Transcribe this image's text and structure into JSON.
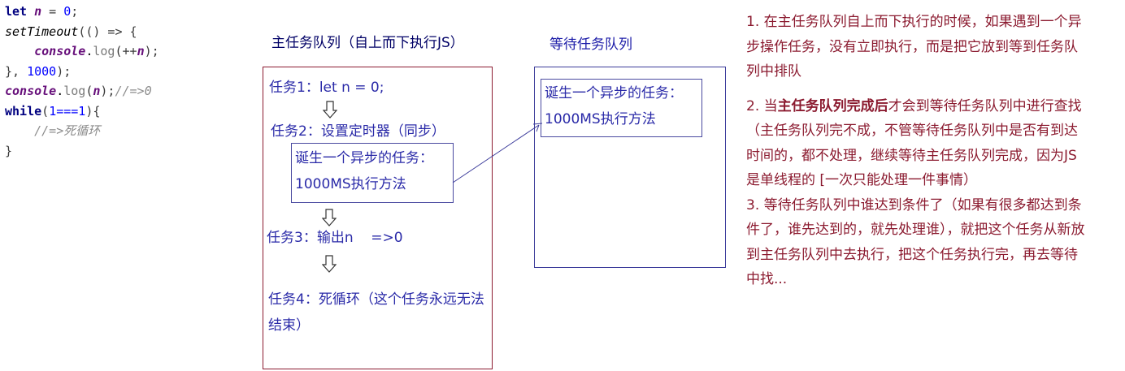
{
  "code": {
    "l1_kw": "let",
    "l1_var": "n",
    "l1_rest": " = ",
    "l1_num": "0",
    "l1_end": ";",
    "l2_fn": "setTimeout",
    "l2_rest": "(() => {",
    "l3_obj": "console",
    "l3_dot": ".",
    "l3_method": "log",
    "l3_open": "(++",
    "l3_var": "n",
    "l3_close": ");",
    "l4_start": "}, ",
    "l4_num": "1000",
    "l4_end": ");",
    "l5_obj": "console",
    "l5_dot": ".",
    "l5_method": "log",
    "l5_open": "(",
    "l5_var": "n",
    "l5_close": ");",
    "l5_comment": "//=>0",
    "l6_kw": "while",
    "l6_rest": "(",
    "l6_cond": "1===1",
    "l6_end": "){",
    "l7_comment": "//=>死循环",
    "l8": "}"
  },
  "diagram": {
    "main_title": "主任务队列（自上而下执行JS）",
    "wait_title": "等待任务队列",
    "task1": "任务1：let n = 0;",
    "task2": "任务2：设置定时器（同步）",
    "async_line1": "诞生一个异步的任务：",
    "async_line2": "1000MS执行方法",
    "task3": "任务3：输出n    =>0",
    "task4": "任务4：死循环（这个任务永远无法结束）",
    "wait_line1": "诞生一个异步的任务：",
    "wait_line2": "1000MS执行方法",
    "arrow_glyph": "⇩"
  },
  "notes": {
    "n1": "1. 在主任务队列自上而下执行的时候，如果遇到一个异步操作任务，没有立即执行，而是把它放到等到任务队列中排队",
    "n2_prefix": "2. 当",
    "n2_bold": "主任务队列完成后",
    "n2_rest": "才会到等待任务队列中进行查找（主任务队列完不成，不管等待任务队列中是否有到达时间的，都不处理，继续等待主任务队列完成，因为JS是单线程的 [一次只能处理一件事情）",
    "n3": "3. 等待任务队列中谁达到条件了（如果有很多都达到条件了，谁先达到的，就先处理谁），就把这个任务从新放到主任务队列中去执行，把这个任务执行完，再去等待中找..."
  },
  "colors": {
    "main_border": "#8b1a2f",
    "wait_border": "#3b3b9a",
    "task_text": "#2a2aa8",
    "note_text": "#8b1a2f"
  }
}
